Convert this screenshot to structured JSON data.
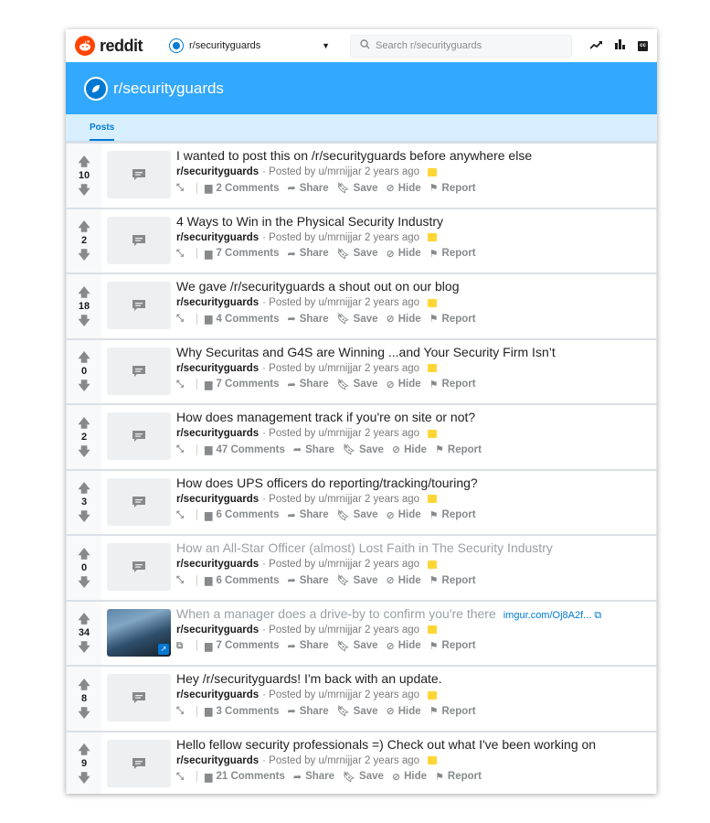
{
  "app": {
    "name": "reddit"
  },
  "subreddit_selector": {
    "label": "r/securityguards"
  },
  "search": {
    "placeholder": "Search r/securityguards"
  },
  "banner": {
    "title": "r/securityguards"
  },
  "tabs": [
    {
      "label": "Posts"
    }
  ],
  "colors": {
    "brand": "#ff4500",
    "banner": "#33a8ff",
    "accent": "#0079d3",
    "tab_bar": "#d7efff",
    "archived": "#ffd635"
  },
  "posts": [
    {
      "score": "10",
      "title": "I wanted to post this on /r/securityguards before anywhere else",
      "subreddit": "r/securityguards",
      "meta": "· Posted by u/mrnijjar 2 years ago",
      "comments": "2 Comments",
      "share": "Share",
      "save": "Save",
      "hide": "Hide",
      "report": "Report"
    },
    {
      "score": "2",
      "title": "4 Ways to Win in the Physical Security Industry",
      "subreddit": "r/securityguards",
      "meta": "· Posted by u/mrnijjar 2 years ago",
      "comments": "7 Comments",
      "share": "Share",
      "save": "Save",
      "hide": "Hide",
      "report": "Report"
    },
    {
      "score": "18",
      "title": "We gave /r/securityguards a shout out on our blog",
      "subreddit": "r/securityguards",
      "meta": "· Posted by u/mrnijjar 2 years ago",
      "comments": "4 Comments",
      "share": "Share",
      "save": "Save",
      "hide": "Hide",
      "report": "Report"
    },
    {
      "score": "0",
      "title": "Why Securitas and G4S are Winning ...and Your Security Firm Isn’t",
      "subreddit": "r/securityguards",
      "meta": "· Posted by u/mrnijjar 2 years ago",
      "comments": "7 Comments",
      "share": "Share",
      "save": "Save",
      "hide": "Hide",
      "report": "Report"
    },
    {
      "score": "2",
      "title": "How does management track if you're on site or not?",
      "subreddit": "r/securityguards",
      "meta": "· Posted by u/mrnijjar 2 years ago",
      "comments": "47 Comments",
      "share": "Share",
      "save": "Save",
      "hide": "Hide",
      "report": "Report"
    },
    {
      "score": "3",
      "title": "How does UPS officers do reporting/tracking/touring?",
      "subreddit": "r/securityguards",
      "meta": "· Posted by u/mrnijjar 2 years ago",
      "comments": "6 Comments",
      "share": "Share",
      "save": "Save",
      "hide": "Hide",
      "report": "Report"
    },
    {
      "score": "0",
      "title": "How an All-Star Officer (almost) Lost Faith in The Security Industry",
      "subreddit": "r/securityguards",
      "meta": "· Posted by u/mrnijjar 2 years ago",
      "comments": "6 Comments",
      "share": "Share",
      "save": "Save",
      "hide": "Hide",
      "report": "Report"
    },
    {
      "score": "34",
      "title": "When a manager does a drive-by to confirm you're there",
      "domain": "imgur.com/Oj8A2f...",
      "subreddit": "r/securityguards",
      "meta": "· Posted by u/mrnijjar 2 years ago",
      "comments": "7 Comments",
      "share": "Share",
      "save": "Save",
      "hide": "Hide",
      "report": "Report"
    },
    {
      "score": "8",
      "title": "Hey /r/securityguards! I'm back with an update.",
      "subreddit": "r/securityguards",
      "meta": "· Posted by u/mrnijjar 2 years ago",
      "comments": "3 Comments",
      "share": "Share",
      "save": "Save",
      "hide": "Hide",
      "report": "Report"
    },
    {
      "score": "9",
      "title": "Hello fellow security professionals =) Check out what I've been working on",
      "subreddit": "r/securityguards",
      "meta": "· Posted by u/mrnijjar 2 years ago",
      "comments": "21 Comments",
      "share": "Share",
      "save": "Save",
      "hide": "Hide",
      "report": "Report"
    }
  ]
}
